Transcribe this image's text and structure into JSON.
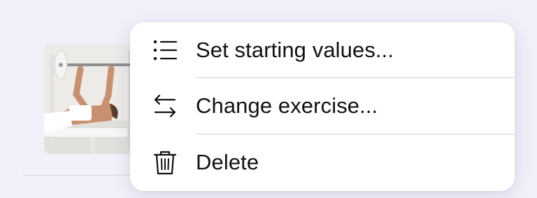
{
  "exercise_row": {
    "image_alt": "bench-press-thumbnail"
  },
  "context_menu": {
    "items": [
      {
        "label": "Set starting values...",
        "icon": "list-icon"
      },
      {
        "label": "Change exercise...",
        "icon": "swap-arrows-icon"
      },
      {
        "label": "Delete",
        "icon": "trash-icon"
      }
    ]
  }
}
